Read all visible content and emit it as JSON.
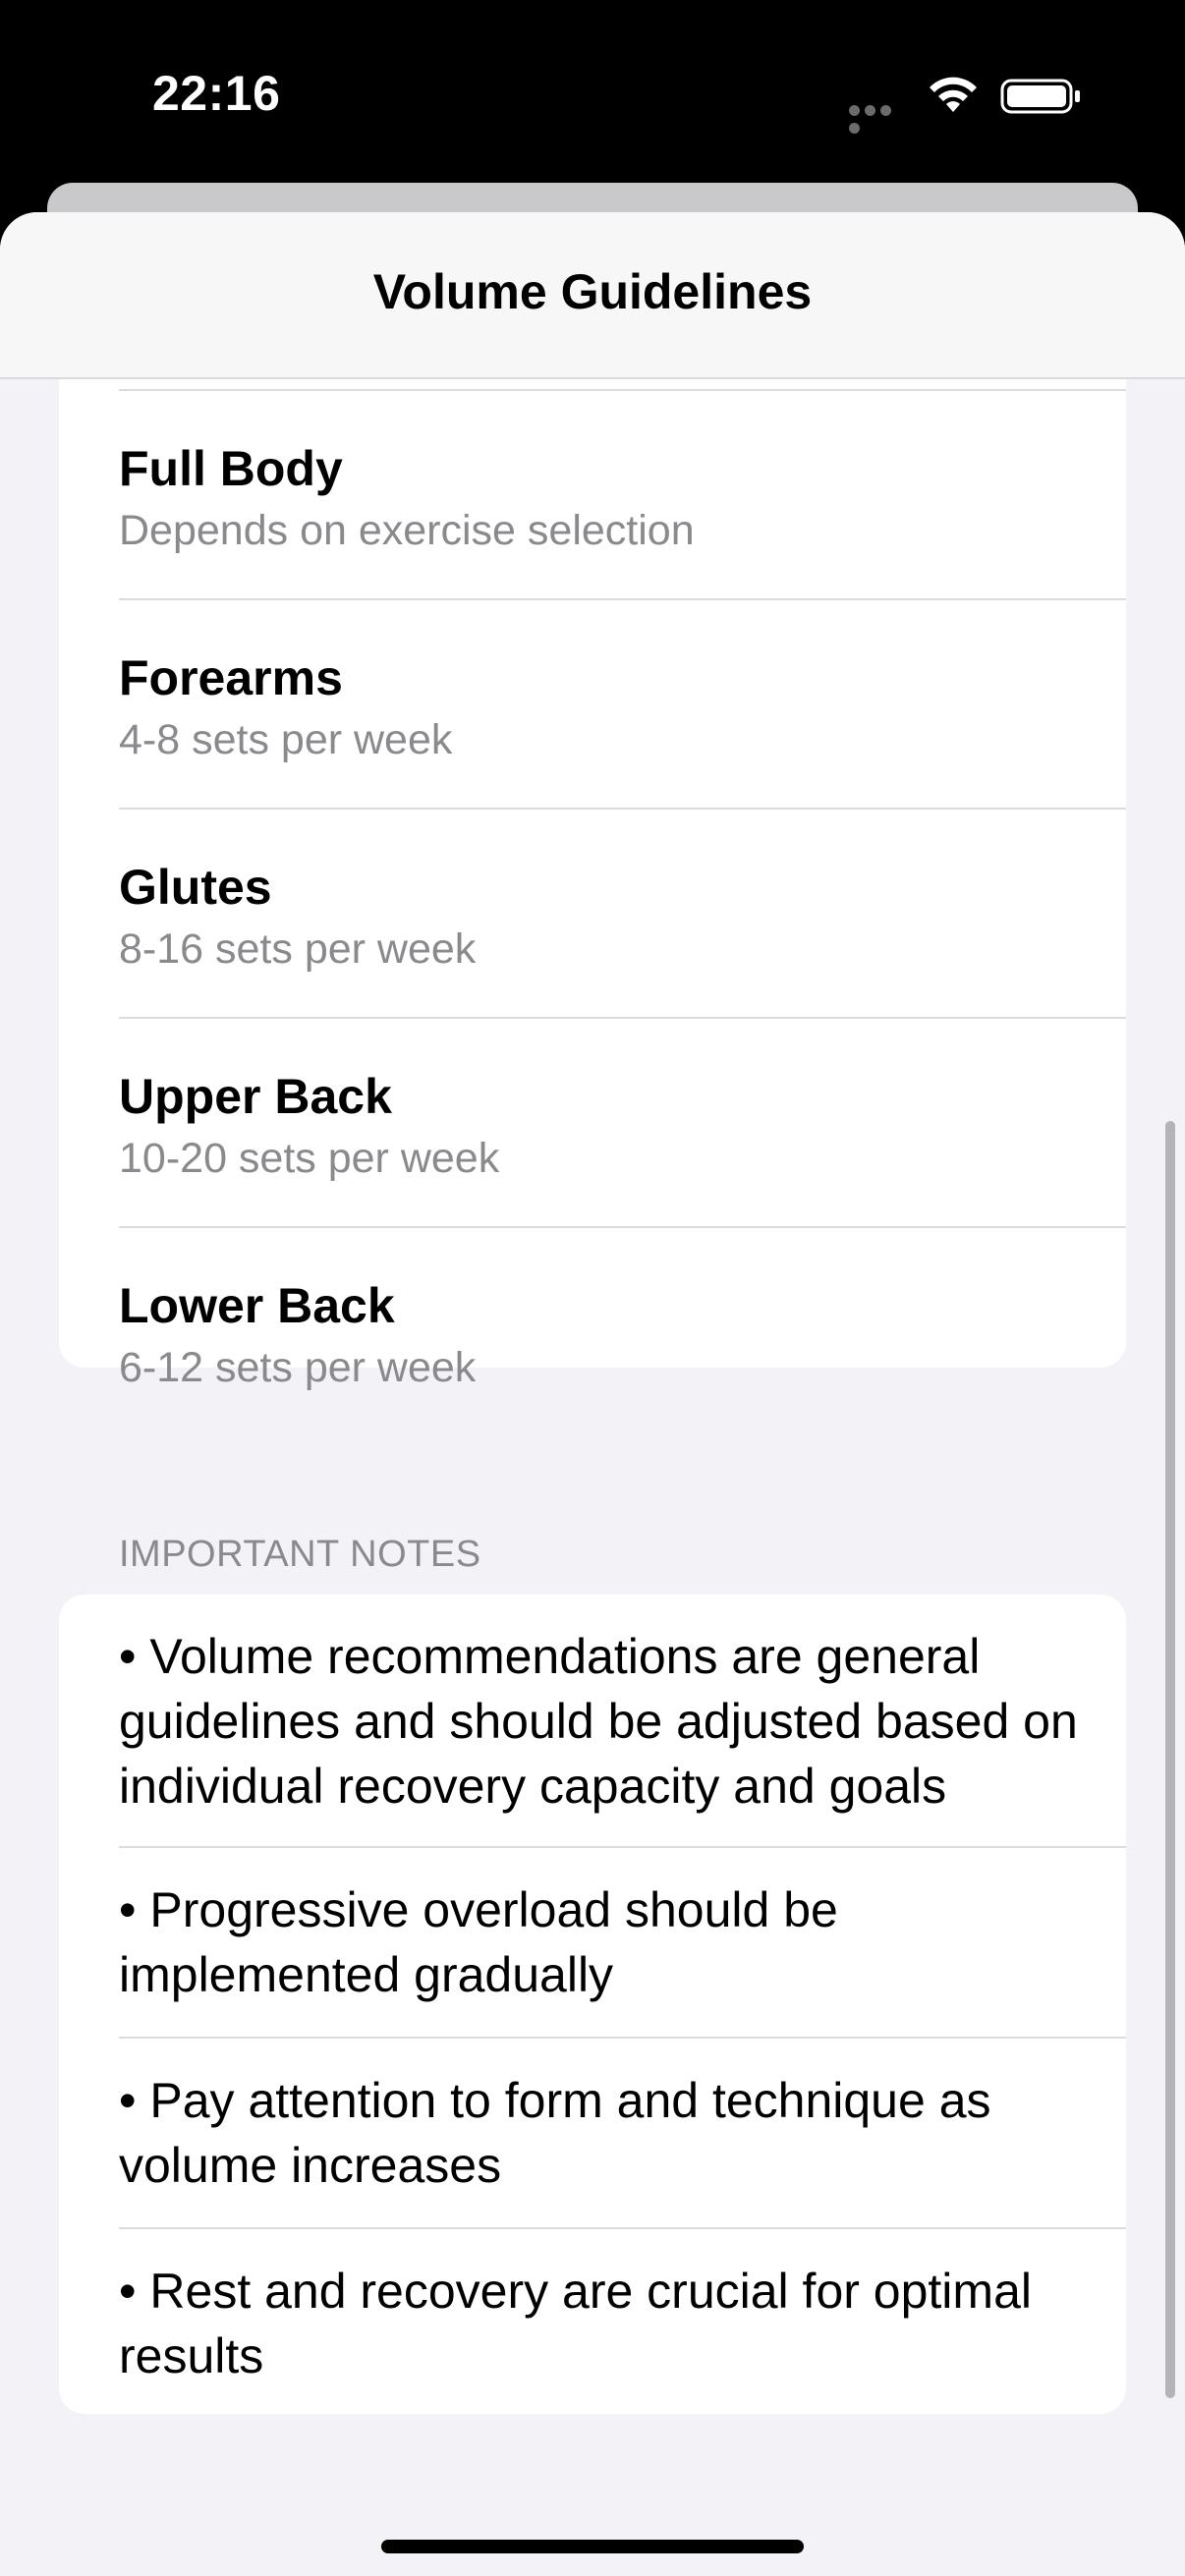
{
  "status_bar": {
    "time": "22:16",
    "icons": [
      "signal-dots-icon",
      "wifi-icon",
      "battery-icon"
    ]
  },
  "nav": {
    "title": "Volume Guidelines"
  },
  "muscle_groups": [
    {
      "name": "Full Body",
      "guideline": "Depends on exercise selection"
    },
    {
      "name": "Forearms",
      "guideline": "4-8 sets per week"
    },
    {
      "name": "Glutes",
      "guideline": "8-16 sets per week"
    },
    {
      "name": "Upper Back",
      "guideline": "10-20 sets per week"
    },
    {
      "name": "Lower Back",
      "guideline": "6-12 sets per week"
    }
  ],
  "notes_section": {
    "header": "IMPORTANT NOTES",
    "notes": [
      "• Volume recommendations are general guidelines and should be adjusted based on individual recovery capacity and goals",
      "• Progressive overload should be implemented gradually",
      "• Pay attention to form and technique as volume increases",
      "• Rest and recovery are crucial for optimal results"
    ]
  },
  "colors": {
    "background": "#f2f2f7",
    "card": "#ffffff",
    "primary_text": "#000000",
    "secondary_text": "#8a8a8e",
    "status_bar": "#000000"
  }
}
